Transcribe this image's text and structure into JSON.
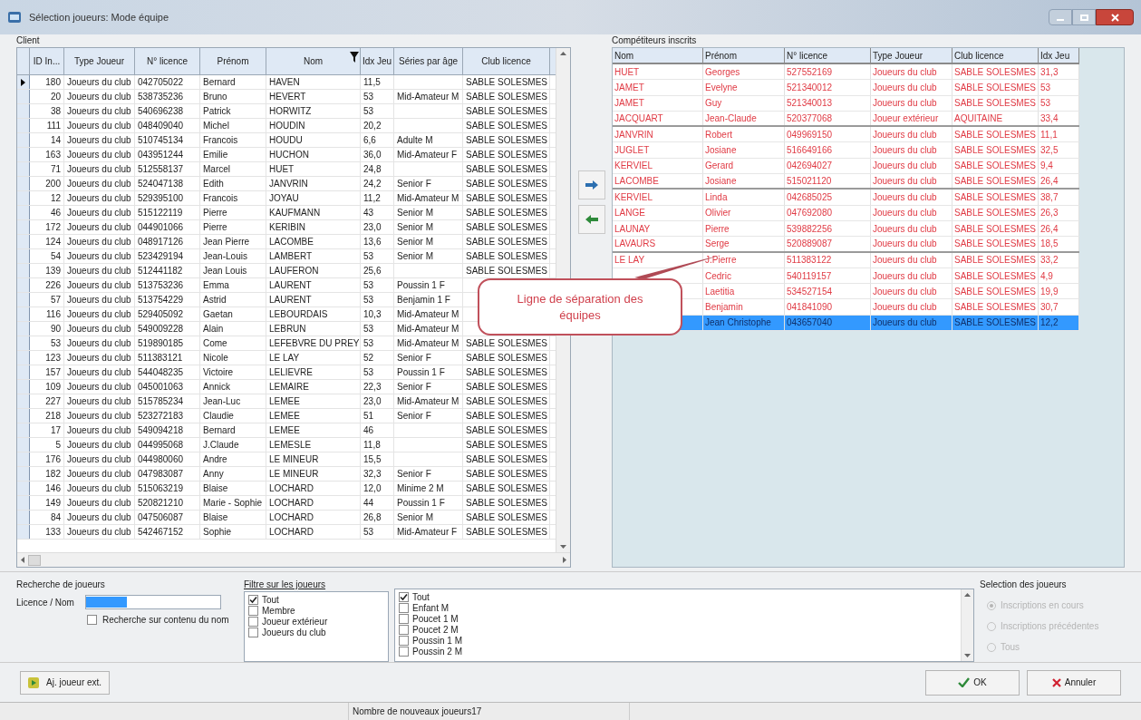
{
  "window": {
    "title": "Sélection joueurs: Mode équipe"
  },
  "client": {
    "label": "Client",
    "columns": [
      "ID In...",
      "Type Joueur",
      "N° licence",
      "Prénom",
      "Nom",
      "Idx Jeu",
      "Séries par âge",
      "Club licence"
    ],
    "rows": [
      {
        "current": true,
        "cells": [
          "180",
          "Joueurs du club",
          "042705022",
          "Bernard",
          "HAVEN",
          "11,5",
          null,
          "SABLE SOLESMES"
        ]
      },
      {
        "current": false,
        "cells": [
          "20",
          "Joueurs du club",
          "538735236",
          "Bruno",
          "HEVERT",
          "53",
          "Mid-Amateur M",
          "SABLE SOLESMES"
        ]
      },
      {
        "current": false,
        "cells": [
          "38",
          "Joueurs du club",
          "540696238",
          "Patrick",
          "HORWITZ",
          "53",
          null,
          "SABLE SOLESMES"
        ]
      },
      {
        "current": false,
        "cells": [
          "111",
          "Joueurs du club",
          "048409040",
          "Michel",
          "HOUDIN",
          "20,2",
          null,
          "SABLE SOLESMES"
        ]
      },
      {
        "current": false,
        "cells": [
          "14",
          "Joueurs du club",
          "510745134",
          "Francois",
          "HOUDU",
          "6,6",
          "Adulte M",
          "SABLE SOLESMES"
        ]
      },
      {
        "current": false,
        "cells": [
          "163",
          "Joueurs du club",
          "043951244",
          "Emilie",
          "HUCHON",
          "36,0",
          "Mid-Amateur F",
          "SABLE SOLESMES"
        ]
      },
      {
        "current": false,
        "cells": [
          "71",
          "Joueurs du club",
          "512558137",
          "Marcel",
          "HUET",
          "24,8",
          null,
          "SABLE SOLESMES"
        ]
      },
      {
        "current": false,
        "cells": [
          "200",
          "Joueurs du club",
          "524047138",
          "Edith",
          "JANVRIN",
          "24,2",
          "Senior F",
          "SABLE SOLESMES"
        ]
      },
      {
        "current": false,
        "cells": [
          "12",
          "Joueurs du club",
          "529395100",
          "Francois",
          "JOYAU",
          "11,2",
          "Mid-Amateur M",
          "SABLE SOLESMES"
        ]
      },
      {
        "current": false,
        "cells": [
          "46",
          "Joueurs du club",
          "515122119",
          "Pierre",
          "KAUFMANN",
          "43",
          "Senior M",
          "SABLE SOLESMES"
        ]
      },
      {
        "current": false,
        "cells": [
          "172",
          "Joueurs du club",
          "044901066",
          "Pierre",
          "KERIBIN",
          "23,0",
          "Senior M",
          "SABLE SOLESMES"
        ]
      },
      {
        "current": false,
        "cells": [
          "124",
          "Joueurs du club",
          "048917126",
          "Jean Pierre",
          "LACOMBE",
          "13,6",
          "Senior M",
          "SABLE SOLESMES"
        ]
      },
      {
        "current": false,
        "cells": [
          "54",
          "Joueurs du club",
          "523429194",
          "Jean-Louis",
          "LAMBERT",
          "53",
          "Senior M",
          "SABLE SOLESMES"
        ]
      },
      {
        "current": false,
        "cells": [
          "139",
          "Joueurs du club",
          "512441182",
          "Jean Louis",
          "LAUFERON",
          "25,6",
          null,
          "SABLE SOLESMES"
        ]
      },
      {
        "current": false,
        "cells": [
          "226",
          "Joueurs du club",
          "513753236",
          "Emma",
          "LAURENT",
          "53",
          "Poussin 1 F",
          null
        ]
      },
      {
        "current": false,
        "cells": [
          "57",
          "Joueurs du club",
          "513754229",
          "Astrid",
          "LAURENT",
          "53",
          "Benjamin 1 F",
          null
        ]
      },
      {
        "current": false,
        "cells": [
          "116",
          "Joueurs du club",
          "529405092",
          "Gaetan",
          "LEBOURDAIS",
          "10,3",
          "Mid-Amateur M",
          null
        ]
      },
      {
        "current": false,
        "cells": [
          "90",
          "Joueurs du club",
          "549009228",
          "Alain",
          "LEBRUN",
          "53",
          "Mid-Amateur M",
          null
        ]
      },
      {
        "current": false,
        "cells": [
          "53",
          "Joueurs du club",
          "519890185",
          "Come",
          "LEFEBVRE DU PREY",
          "53",
          "Mid-Amateur M",
          "SABLE SOLESMES"
        ]
      },
      {
        "current": false,
        "cells": [
          "123",
          "Joueurs du club",
          "511383121",
          "Nicole",
          "LE LAY",
          "52",
          "Senior F",
          "SABLE SOLESMES"
        ]
      },
      {
        "current": false,
        "cells": [
          "157",
          "Joueurs du club",
          "544048235",
          "Victoire",
          "LELIEVRE",
          "53",
          "Poussin 1 F",
          "SABLE SOLESMES"
        ]
      },
      {
        "current": false,
        "cells": [
          "109",
          "Joueurs du club",
          "045001063",
          "Annick",
          "LEMAIRE",
          "22,3",
          "Senior F",
          "SABLE SOLESMES"
        ]
      },
      {
        "current": false,
        "cells": [
          "227",
          "Joueurs du club",
          "515785234",
          "Jean-Luc",
          "LEMEE",
          "23,0",
          "Mid-Amateur M",
          "SABLE SOLESMES"
        ]
      },
      {
        "current": false,
        "cells": [
          "218",
          "Joueurs du club",
          "523272183",
          "Claudie",
          "LEMEE",
          "51",
          "Senior F",
          "SABLE SOLESMES"
        ]
      },
      {
        "current": false,
        "cells": [
          "17",
          "Joueurs du club",
          "549094218",
          "Bernard",
          "LEMEE",
          "46",
          null,
          "SABLE SOLESMES"
        ]
      },
      {
        "current": false,
        "cells": [
          "5",
          "Joueurs du club",
          "044995068",
          "J.Claude",
          "LEMESLE",
          "11,8",
          null,
          "SABLE SOLESMES"
        ]
      },
      {
        "current": false,
        "cells": [
          "176",
          "Joueurs du club",
          "044980060",
          "Andre",
          "LE MINEUR",
          "15,5",
          null,
          "SABLE SOLESMES"
        ]
      },
      {
        "current": false,
        "cells": [
          "182",
          "Joueurs du club",
          "047983087",
          "Anny",
          "LE MINEUR",
          "32,3",
          "Senior F",
          "SABLE SOLESMES"
        ]
      },
      {
        "current": false,
        "cells": [
          "146",
          "Joueurs du club",
          "515063219",
          "Blaise",
          "LOCHARD",
          "12,0",
          "Minime 2 M",
          "SABLE SOLESMES"
        ]
      },
      {
        "current": false,
        "cells": [
          "149",
          "Joueurs du club",
          "520821210",
          "Marie - Sophie",
          "LOCHARD",
          "44",
          "Poussin 1 F",
          "SABLE SOLESMES"
        ]
      },
      {
        "current": false,
        "cells": [
          "84",
          "Joueurs du club",
          "047506087",
          "Blaise",
          "LOCHARD",
          "26,8",
          "Senior M",
          "SABLE SOLESMES"
        ]
      },
      {
        "current": false,
        "cells": [
          "133",
          "Joueurs du club",
          "542467152",
          "Sophie",
          "LOCHARD",
          "53",
          "Mid-Amateur F",
          "SABLE SOLESMES"
        ]
      }
    ]
  },
  "competitors": {
    "label": "Compétiteurs inscrits",
    "columns": [
      "Nom",
      "Prénom",
      "N° licence",
      "Type Joueur",
      "Club licence",
      "Idx Jeu"
    ],
    "rows": [
      {
        "selected": false,
        "team_end": false,
        "cells": [
          "HUET",
          "Georges",
          "527552169",
          "Joueurs du club",
          "SABLE SOLESMES",
          "31,3"
        ]
      },
      {
        "selected": false,
        "team_end": false,
        "cells": [
          "JAMET",
          "Evelyne",
          "521340012",
          "Joueurs du club",
          "SABLE SOLESMES",
          "53"
        ]
      },
      {
        "selected": false,
        "team_end": false,
        "cells": [
          "JAMET",
          "Guy",
          "521340013",
          "Joueurs du club",
          "SABLE SOLESMES",
          "53"
        ]
      },
      {
        "selected": false,
        "team_end": true,
        "cells": [
          "JACQUART",
          "Jean-Claude",
          "520377068",
          "Joueur extérieur",
          "AQUITAINE",
          "33,4"
        ]
      },
      {
        "selected": false,
        "team_end": false,
        "cells": [
          "JANVRIN",
          "Robert",
          "049969150",
          "Joueurs du club",
          "SABLE SOLESMES",
          "11,1"
        ]
      },
      {
        "selected": false,
        "team_end": false,
        "cells": [
          "JUGLET",
          "Josiane",
          "516649166",
          "Joueurs du club",
          "SABLE SOLESMES",
          "32,5"
        ]
      },
      {
        "selected": false,
        "team_end": false,
        "cells": [
          "KERVIEL",
          "Gerard",
          "042694027",
          "Joueurs du club",
          "SABLE SOLESMES",
          "9,4"
        ]
      },
      {
        "selected": false,
        "team_end": true,
        "cells": [
          "LACOMBE",
          "Josiane",
          "515021120",
          "Joueurs du club",
          "SABLE SOLESMES",
          "26,4"
        ]
      },
      {
        "selected": false,
        "team_end": false,
        "cells": [
          "KERVIEL",
          "Linda",
          "042685025",
          "Joueurs du club",
          "SABLE SOLESMES",
          "38,7"
        ]
      },
      {
        "selected": false,
        "team_end": false,
        "cells": [
          "LANGE",
          "Olivier",
          "047692080",
          "Joueurs du club",
          "SABLE SOLESMES",
          "26,3"
        ]
      },
      {
        "selected": false,
        "team_end": false,
        "cells": [
          "LAUNAY",
          "Pierre",
          "539882256",
          "Joueurs du club",
          "SABLE SOLESMES",
          "26,4"
        ]
      },
      {
        "selected": false,
        "team_end": true,
        "cells": [
          "LAVAURS",
          "Serge",
          "520889087",
          "Joueurs du club",
          "SABLE SOLESMES",
          "18,5"
        ]
      },
      {
        "selected": false,
        "team_end": false,
        "cells": [
          "LE LAY",
          "J.Pierre",
          "511383122",
          "Joueurs du club",
          "SABLE SOLESMES",
          "33,2"
        ]
      },
      {
        "selected": false,
        "team_end": false,
        "cells": [
          null,
          "Cedric",
          "540119157",
          "Joueurs du club",
          "SABLE SOLESMES",
          "4,9"
        ]
      },
      {
        "selected": false,
        "team_end": false,
        "cells": [
          null,
          "Laetitia",
          "534527154",
          "Joueurs du club",
          "SABLE SOLESMES",
          "19,9"
        ]
      },
      {
        "selected": false,
        "team_end": false,
        "cells": [
          null,
          "Benjamin",
          "041841090",
          "Joueurs du club",
          "SABLE SOLESMES",
          "30,7"
        ]
      },
      {
        "selected": true,
        "team_end": false,
        "cells": [
          null,
          "Jean Christophe",
          "043657040",
          "Joueurs du club",
          "SABLE SOLESMES",
          "12,2"
        ]
      }
    ]
  },
  "callout": {
    "text": "Ligne de séparation des équipes"
  },
  "search": {
    "title": "Recherche de joueurs",
    "field_label": "Licence / Nom",
    "content_search": {
      "label": "Recherche sur contenu du nom",
      "checked": false
    }
  },
  "filter": {
    "title": "Filtre sur les joueurs",
    "types": [
      {
        "label": "Tout",
        "checked": true
      },
      {
        "label": "Membre",
        "checked": false
      },
      {
        "label": "Joueur extérieur",
        "checked": false
      },
      {
        "label": "Joueurs du club",
        "checked": false
      }
    ],
    "series": [
      {
        "label": "Tout",
        "checked": true
      },
      {
        "label": "Enfant M",
        "checked": false
      },
      {
        "label": "Poucet 1 M",
        "checked": false
      },
      {
        "label": "Poucet 2 M",
        "checked": false
      },
      {
        "label": "Poussin 1 M",
        "checked": false
      },
      {
        "label": "Poussin 2 M",
        "checked": false
      }
    ]
  },
  "selection": {
    "title": "Selection des joueurs",
    "disabled": true,
    "options": [
      {
        "label": "Inscriptions en cours",
        "selected": true
      },
      {
        "label": "Inscriptions précédentes",
        "selected": false
      },
      {
        "label": "Tous",
        "selected": false
      }
    ]
  },
  "buttons": {
    "add_external": "Aj. joueur ext.",
    "ok": "OK",
    "cancel": "Annuler"
  },
  "status_bar": {
    "text": "Nombre de nouveaux joueurs17"
  }
}
